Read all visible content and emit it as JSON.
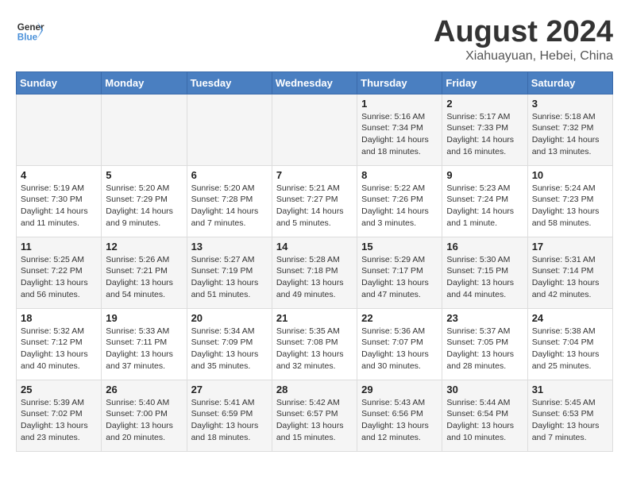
{
  "header": {
    "logo_line1": "General",
    "logo_line2": "Blue",
    "title": "August 2024",
    "subtitle": "Xiahuayuan, Hebei, China"
  },
  "weekdays": [
    "Sunday",
    "Monday",
    "Tuesday",
    "Wednesday",
    "Thursday",
    "Friday",
    "Saturday"
  ],
  "weeks": [
    [
      {
        "day": "",
        "info": ""
      },
      {
        "day": "",
        "info": ""
      },
      {
        "day": "",
        "info": ""
      },
      {
        "day": "",
        "info": ""
      },
      {
        "day": "1",
        "info": "Sunrise: 5:16 AM\nSunset: 7:34 PM\nDaylight: 14 hours\nand 18 minutes."
      },
      {
        "day": "2",
        "info": "Sunrise: 5:17 AM\nSunset: 7:33 PM\nDaylight: 14 hours\nand 16 minutes."
      },
      {
        "day": "3",
        "info": "Sunrise: 5:18 AM\nSunset: 7:32 PM\nDaylight: 14 hours\nand 13 minutes."
      }
    ],
    [
      {
        "day": "4",
        "info": "Sunrise: 5:19 AM\nSunset: 7:30 PM\nDaylight: 14 hours\nand 11 minutes."
      },
      {
        "day": "5",
        "info": "Sunrise: 5:20 AM\nSunset: 7:29 PM\nDaylight: 14 hours\nand 9 minutes."
      },
      {
        "day": "6",
        "info": "Sunrise: 5:20 AM\nSunset: 7:28 PM\nDaylight: 14 hours\nand 7 minutes."
      },
      {
        "day": "7",
        "info": "Sunrise: 5:21 AM\nSunset: 7:27 PM\nDaylight: 14 hours\nand 5 minutes."
      },
      {
        "day": "8",
        "info": "Sunrise: 5:22 AM\nSunset: 7:26 PM\nDaylight: 14 hours\nand 3 minutes."
      },
      {
        "day": "9",
        "info": "Sunrise: 5:23 AM\nSunset: 7:24 PM\nDaylight: 14 hours\nand 1 minute."
      },
      {
        "day": "10",
        "info": "Sunrise: 5:24 AM\nSunset: 7:23 PM\nDaylight: 13 hours\nand 58 minutes."
      }
    ],
    [
      {
        "day": "11",
        "info": "Sunrise: 5:25 AM\nSunset: 7:22 PM\nDaylight: 13 hours\nand 56 minutes."
      },
      {
        "day": "12",
        "info": "Sunrise: 5:26 AM\nSunset: 7:21 PM\nDaylight: 13 hours\nand 54 minutes."
      },
      {
        "day": "13",
        "info": "Sunrise: 5:27 AM\nSunset: 7:19 PM\nDaylight: 13 hours\nand 51 minutes."
      },
      {
        "day": "14",
        "info": "Sunrise: 5:28 AM\nSunset: 7:18 PM\nDaylight: 13 hours\nand 49 minutes."
      },
      {
        "day": "15",
        "info": "Sunrise: 5:29 AM\nSunset: 7:17 PM\nDaylight: 13 hours\nand 47 minutes."
      },
      {
        "day": "16",
        "info": "Sunrise: 5:30 AM\nSunset: 7:15 PM\nDaylight: 13 hours\nand 44 minutes."
      },
      {
        "day": "17",
        "info": "Sunrise: 5:31 AM\nSunset: 7:14 PM\nDaylight: 13 hours\nand 42 minutes."
      }
    ],
    [
      {
        "day": "18",
        "info": "Sunrise: 5:32 AM\nSunset: 7:12 PM\nDaylight: 13 hours\nand 40 minutes."
      },
      {
        "day": "19",
        "info": "Sunrise: 5:33 AM\nSunset: 7:11 PM\nDaylight: 13 hours\nand 37 minutes."
      },
      {
        "day": "20",
        "info": "Sunrise: 5:34 AM\nSunset: 7:09 PM\nDaylight: 13 hours\nand 35 minutes."
      },
      {
        "day": "21",
        "info": "Sunrise: 5:35 AM\nSunset: 7:08 PM\nDaylight: 13 hours\nand 32 minutes."
      },
      {
        "day": "22",
        "info": "Sunrise: 5:36 AM\nSunset: 7:07 PM\nDaylight: 13 hours\nand 30 minutes."
      },
      {
        "day": "23",
        "info": "Sunrise: 5:37 AM\nSunset: 7:05 PM\nDaylight: 13 hours\nand 28 minutes."
      },
      {
        "day": "24",
        "info": "Sunrise: 5:38 AM\nSunset: 7:04 PM\nDaylight: 13 hours\nand 25 minutes."
      }
    ],
    [
      {
        "day": "25",
        "info": "Sunrise: 5:39 AM\nSunset: 7:02 PM\nDaylight: 13 hours\nand 23 minutes."
      },
      {
        "day": "26",
        "info": "Sunrise: 5:40 AM\nSunset: 7:00 PM\nDaylight: 13 hours\nand 20 minutes."
      },
      {
        "day": "27",
        "info": "Sunrise: 5:41 AM\nSunset: 6:59 PM\nDaylight: 13 hours\nand 18 minutes."
      },
      {
        "day": "28",
        "info": "Sunrise: 5:42 AM\nSunset: 6:57 PM\nDaylight: 13 hours\nand 15 minutes."
      },
      {
        "day": "29",
        "info": "Sunrise: 5:43 AM\nSunset: 6:56 PM\nDaylight: 13 hours\nand 12 minutes."
      },
      {
        "day": "30",
        "info": "Sunrise: 5:44 AM\nSunset: 6:54 PM\nDaylight: 13 hours\nand 10 minutes."
      },
      {
        "day": "31",
        "info": "Sunrise: 5:45 AM\nSunset: 6:53 PM\nDaylight: 13 hours\nand 7 minutes."
      }
    ]
  ]
}
